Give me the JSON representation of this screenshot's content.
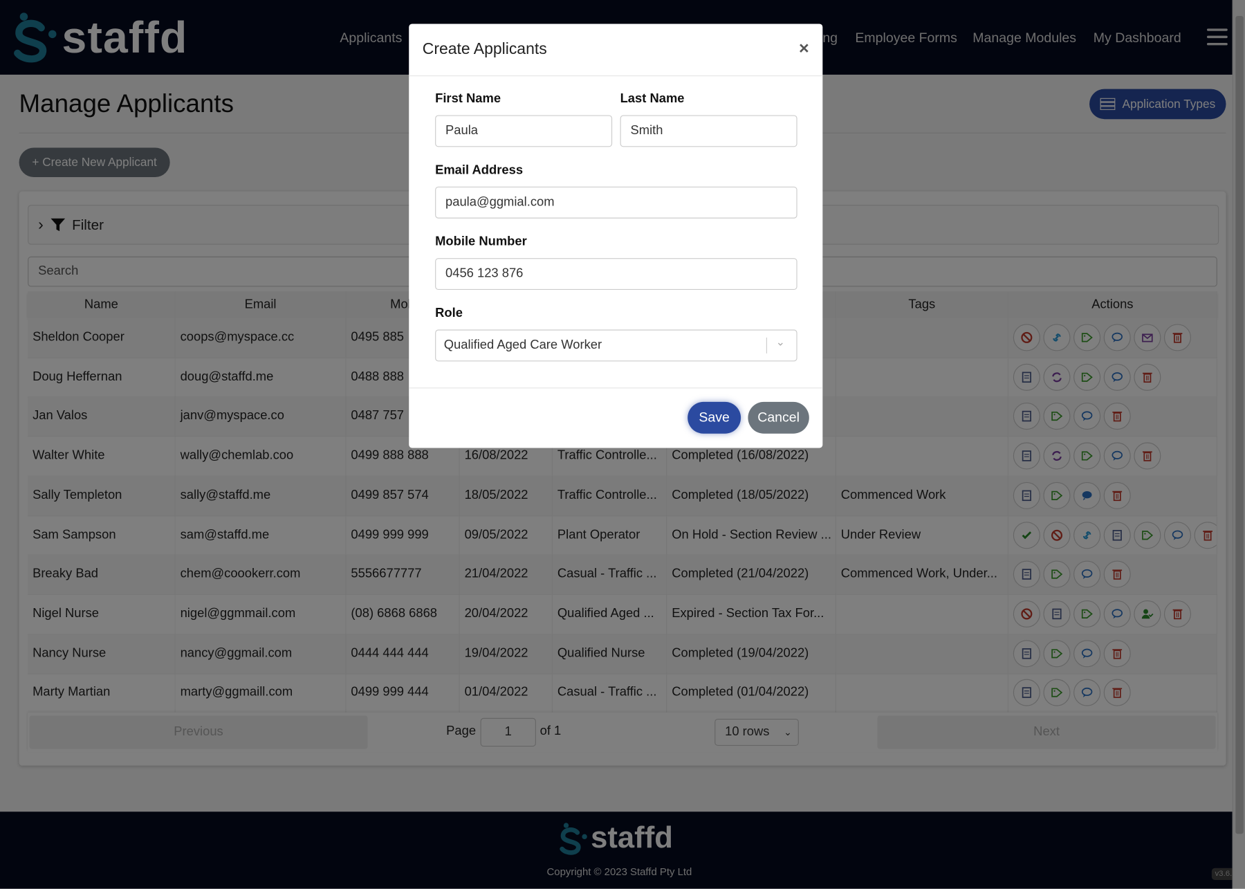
{
  "nav": {
    "brand": "staffd",
    "links": [
      "Applicants",
      "ng",
      "Employee Forms",
      "Manage Modules",
      "My Dashboard"
    ]
  },
  "page": {
    "title": "Manage Applicants",
    "application_types": "Application Types",
    "create_new": "+ Create New Applicant",
    "filter": "Filter",
    "search_placeholder": "Search"
  },
  "table": {
    "headers": [
      "Name",
      "Email",
      "Mob",
      "",
      "",
      "",
      "Tags",
      "Actions"
    ],
    "rows": [
      {
        "cells": [
          "Sheldon Cooper",
          "coops@myspace.cc",
          "0495 885",
          "",
          "",
          "",
          ""
        ],
        "actions": [
          "ban",
          "link",
          "tag",
          "comment",
          "envelope",
          "trash"
        ]
      },
      {
        "cells": [
          "Doug Heffernan",
          "doug@staffd.me",
          "0488 888",
          "",
          "",
          "",
          ""
        ],
        "actions": [
          "form",
          "sync",
          "tag",
          "comment",
          "trash"
        ]
      },
      {
        "cells": [
          "Jan Valos",
          "janv@myspace.co",
          "0487 757",
          "",
          "",
          "",
          ""
        ],
        "actions": [
          "form",
          "tag",
          "comment",
          "trash"
        ]
      },
      {
        "cells": [
          "Walter White",
          "wally@chemlab.coo",
          "0499 888 888",
          "16/08/2022",
          "Traffic Controlle...",
          "Completed (16/08/2022)",
          ""
        ],
        "actions": [
          "form",
          "sync",
          "tag",
          "comment",
          "trash"
        ]
      },
      {
        "cells": [
          "Sally Templeton",
          "sally@staffd.me",
          "0499 857 574",
          "18/05/2022",
          "Traffic Controlle...",
          "Completed (18/05/2022)",
          "Commenced Work"
        ],
        "actions": [
          "form",
          "tag",
          "comment-filled",
          "trash"
        ]
      },
      {
        "cells": [
          "Sam Sampson",
          "sam@staffd.me",
          "0499 999 999",
          "09/05/2022",
          "Plant Operator",
          "On Hold - Section Review ...",
          "Under Review"
        ],
        "actions": [
          "check",
          "ban",
          "link",
          "form",
          "tag",
          "comment",
          "trash"
        ]
      },
      {
        "cells": [
          "Breaky Bad",
          "chem@coookerr.com",
          "5556677777",
          "21/04/2022",
          "Casual - Traffic ...",
          "Completed (21/04/2022)",
          "Commenced Work, Under..."
        ],
        "actions": [
          "form",
          "tag",
          "comment",
          "trash"
        ]
      },
      {
        "cells": [
          "Nigel Nurse",
          "nigel@ggmmail.com",
          "(08) 6868 6868",
          "20/04/2022",
          "Qualified Aged ...",
          "Expired - Section Tax For...",
          ""
        ],
        "actions": [
          "ban",
          "form",
          "tag",
          "comment",
          "user-check",
          "trash"
        ]
      },
      {
        "cells": [
          "Nancy Nurse",
          "nancy@ggmail.com",
          "0444 444 444",
          "19/04/2022",
          "Qualified Nurse",
          "Completed (19/04/2022)",
          ""
        ],
        "actions": [
          "form",
          "tag",
          "comment",
          "trash"
        ]
      },
      {
        "cells": [
          "Marty Martian",
          "marty@ggmaill.com",
          "0499 999 444",
          "01/04/2022",
          "Casual - Traffic ...",
          "Completed (01/04/2022)",
          ""
        ],
        "actions": [
          "form",
          "tag",
          "comment",
          "trash"
        ]
      }
    ]
  },
  "pager": {
    "previous": "Previous",
    "page_label": "Page",
    "page": "1",
    "of": "of 1",
    "rows": "10 rows",
    "next": "Next"
  },
  "footer": {
    "brand": "staffd",
    "copyright": "Copyright © 2023 Staffd Pty Ltd",
    "version": "v3.6."
  },
  "modal": {
    "title": "Create Applicants",
    "close": "×",
    "first_name_label": "First Name",
    "first_name": "Paula",
    "last_name_label": "Last Name",
    "last_name": "Smith",
    "email_label": "Email Address",
    "email": "paula@ggmial.com",
    "mobile_label": "Mobile Number",
    "mobile": "0456 123 876",
    "role_label": "Role",
    "role": "Qualified Aged Care Worker",
    "save": "Save",
    "cancel": "Cancel"
  },
  "colors": {
    "navy": "#050a1f",
    "primary": "#2b4aa0",
    "secondary": "#6c757d",
    "brand_teal": "#1e7f9a"
  }
}
